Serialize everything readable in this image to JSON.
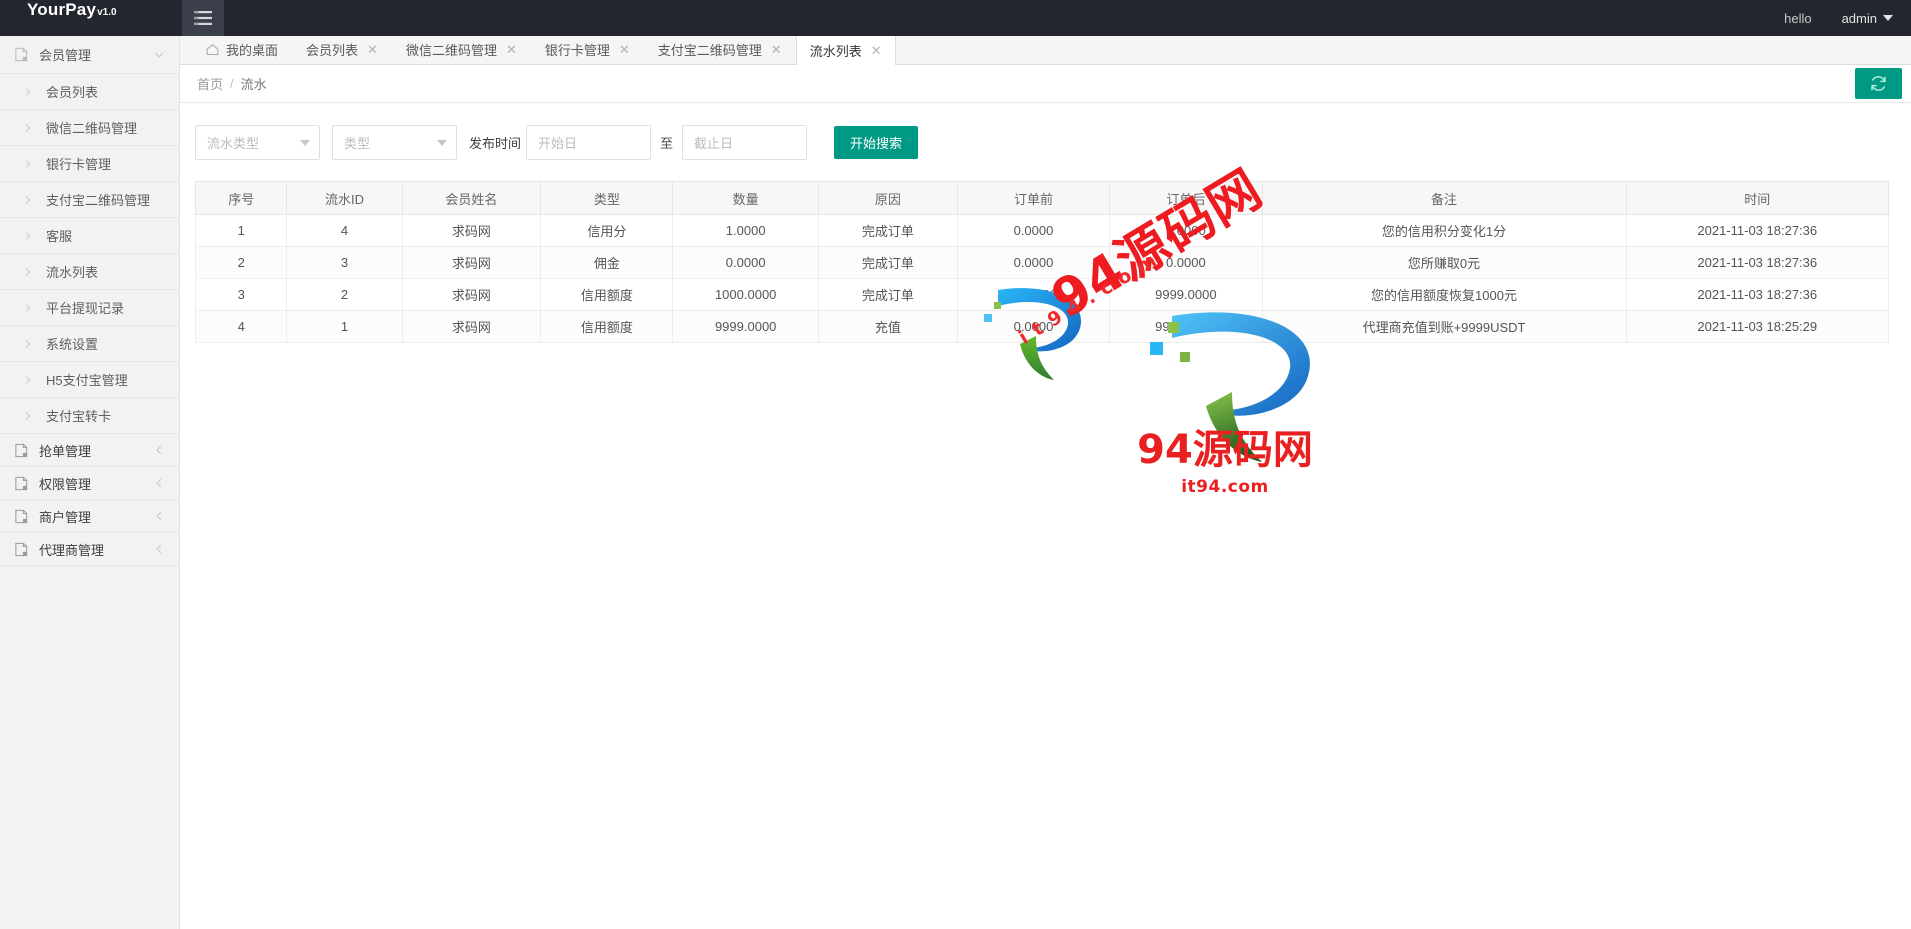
{
  "brand": {
    "name": "YourPay",
    "version": "v1.0"
  },
  "topbar": {
    "hello": "hello",
    "user": "admin",
    "menu_icon": "hamburger-icon",
    "caret_icon": "caret-down-icon"
  },
  "sidebar": {
    "groups": [
      {
        "label": "会员管理",
        "icon": "document-icon",
        "expanded": true,
        "chevron": "chevron-down-icon",
        "items": [
          {
            "label": "会员列表"
          },
          {
            "label": "微信二维码管理"
          },
          {
            "label": "银行卡管理"
          },
          {
            "label": "支付宝二维码管理"
          },
          {
            "label": "客服"
          },
          {
            "label": "流水列表"
          },
          {
            "label": "平台提现记录"
          },
          {
            "label": "系统设置"
          },
          {
            "label": "H5支付宝管理"
          },
          {
            "label": "支付宝转卡"
          }
        ]
      },
      {
        "label": "抢单管理",
        "icon": "document-icon",
        "expanded": false,
        "chevron": "chevron-left-icon",
        "items": []
      },
      {
        "label": "权限管理",
        "icon": "document-icon",
        "expanded": false,
        "chevron": "chevron-left-icon",
        "items": []
      },
      {
        "label": "商户管理",
        "icon": "document-icon",
        "expanded": false,
        "chevron": "chevron-left-icon",
        "items": []
      },
      {
        "label": "代理商管理",
        "icon": "document-icon",
        "expanded": false,
        "chevron": "chevron-left-icon",
        "items": []
      }
    ]
  },
  "tabs": [
    {
      "label": "我的桌面",
      "icon": "home-icon",
      "closable": false,
      "active": false
    },
    {
      "label": "会员列表",
      "icon": "",
      "closable": true,
      "active": false
    },
    {
      "label": "微信二维码管理",
      "icon": "",
      "closable": true,
      "active": false
    },
    {
      "label": "银行卡管理",
      "icon": "",
      "closable": true,
      "active": false
    },
    {
      "label": "支付宝二维码管理",
      "icon": "",
      "closable": true,
      "active": false
    },
    {
      "label": "流水列表",
      "icon": "",
      "closable": true,
      "active": true
    }
  ],
  "breadcrumb": {
    "items": [
      "首页",
      "流水"
    ],
    "separator": "/",
    "refresh_icon": "refresh-icon"
  },
  "filters": {
    "flow_type": {
      "placeholder": "流水类型",
      "value": ""
    },
    "type": {
      "placeholder": "类型",
      "value": ""
    },
    "time_label": "发布时间",
    "start_date": {
      "placeholder": "开始日",
      "value": ""
    },
    "date_separator": "至",
    "end_date": {
      "placeholder": "截止日",
      "value": ""
    },
    "search_button": "开始搜索"
  },
  "table": {
    "columns": [
      "序号",
      "流水ID",
      "会员姓名",
      "类型",
      "数量",
      "原因",
      "订单前",
      "订单后",
      "备注",
      "时间"
    ],
    "rows": [
      {
        "seq": "1",
        "flow_id": "4",
        "member": "求码网",
        "type": "信用分",
        "amount": "1.0000",
        "reason": "完成订单",
        "before": "0.0000",
        "after": "1.0000",
        "remark": "您的信用积分变化1分",
        "time": "2021-11-03 18:27:36"
      },
      {
        "seq": "2",
        "flow_id": "3",
        "member": "求码网",
        "type": "佣金",
        "amount": "0.0000",
        "reason": "完成订单",
        "before": "0.0000",
        "after": "0.0000",
        "remark": "您所赚取0元",
        "time": "2021-11-03 18:27:36"
      },
      {
        "seq": "3",
        "flow_id": "2",
        "member": "求码网",
        "type": "信用额度",
        "amount": "1000.0000",
        "reason": "完成订单",
        "before": "8999.0000",
        "after": "9999.0000",
        "remark": "您的信用额度恢复1000元",
        "time": "2021-11-03 18:27:36"
      },
      {
        "seq": "4",
        "flow_id": "1",
        "member": "求码网",
        "type": "信用额度",
        "amount": "9999.0000",
        "reason": "充值",
        "before": "0.0000",
        "after": "9999.0000",
        "remark": "代理商充值到账+9999USDT",
        "time": "2021-11-03 18:25:29"
      }
    ]
  },
  "watermark": {
    "diagonal": "94源码网",
    "diagonal_small": "it94.com",
    "main": "94源码网",
    "sub": "it94.com"
  },
  "colors": {
    "accent": "#009a84",
    "header_bg": "#23262e",
    "sidebar_bg": "#f2f2f2",
    "watermark_red": "#e8201f"
  }
}
